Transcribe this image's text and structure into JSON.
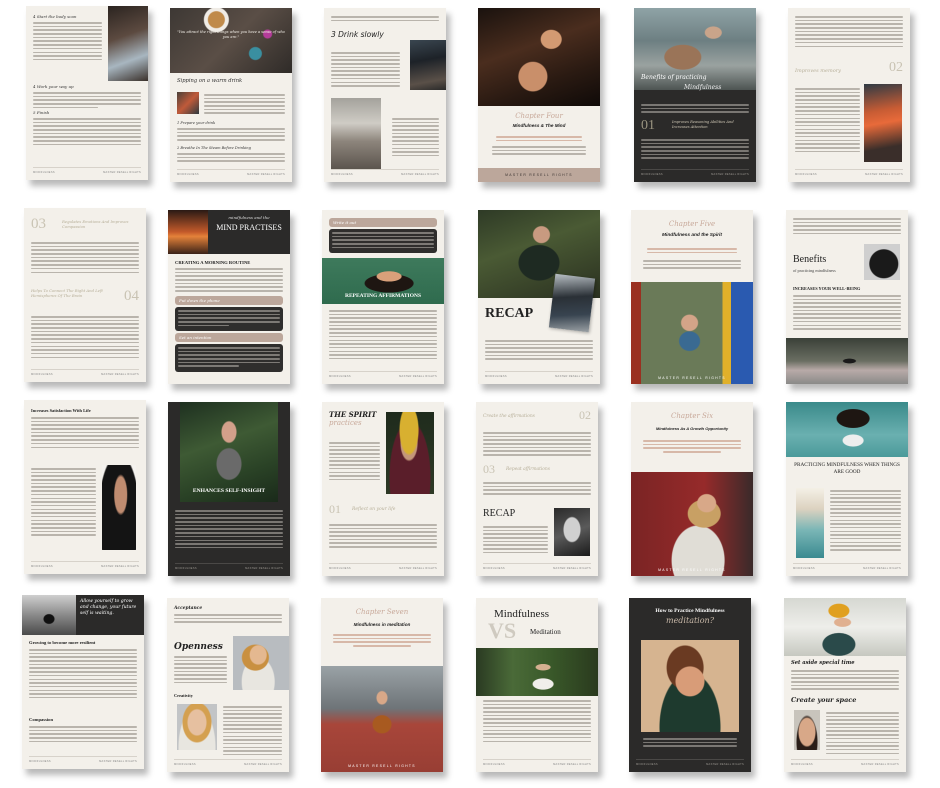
{
  "collage": {
    "footer_left": "MINDFULNESS",
    "footer_right": "MASTER RESELL RIGHTS",
    "brand_band": "MASTER RESELL RIGHTS",
    "pages": [
      {
        "id": "p1",
        "headings": [
          "4 Start the body scan",
          "4 Work your way up",
          "5 Finish"
        ]
      },
      {
        "id": "p2",
        "quote": "\"You attract the right things when you have a sense of who you are.\"",
        "title": "Sipping on a warm drink",
        "subs": [
          "1 Prepare your drink",
          "2 Breathe In The Steam Before Drinking"
        ]
      },
      {
        "id": "p3",
        "title": "3 Drink slowly"
      },
      {
        "id": "p4",
        "script": "Chapter Four",
        "title": "Mindfulness & The Mind",
        "band": "MASTER RESELL RIGHTS"
      },
      {
        "id": "p5",
        "title": "Benefits of practicing",
        "script": "Mindfulness",
        "num": "01",
        "subtitle": "Improves Reasoning Abilities And Increases Attention"
      },
      {
        "id": "p6",
        "subtitle": "Improves memory",
        "num": "02"
      },
      {
        "id": "p7",
        "num1": "03",
        "sub1": "Regulates Emotions And Improves Compassion",
        "num2": "04",
        "sub2": "Helps To Connect The Right And Left Hemispheres Of The Brain"
      },
      {
        "id": "p8",
        "script": "mindfulness and the",
        "title": "MIND PRACTISES",
        "heading": "CREATING A MORNING ROUTINE",
        "pill1": "Put down the phone",
        "pill2": "Set an intention"
      },
      {
        "id": "p9",
        "pill": "Write it out",
        "title": "REPEATING AFFIRMATIONS"
      },
      {
        "id": "p10",
        "title": "RECAP"
      },
      {
        "id": "p11",
        "script": "Chapter Five",
        "title": "Mindfulness and the Spirit",
        "band": "MASTER RESELL RIGHTS"
      },
      {
        "id": "p12",
        "title": "Benefits",
        "subtitle": "of practicing mindfulness",
        "heading": "INCREASES YOUR WELL-BEING"
      },
      {
        "id": "p13",
        "heading": "Increases Satisfaction With Life"
      },
      {
        "id": "p14",
        "title": "ENHANCES SELF-INSIGHT"
      },
      {
        "id": "p15",
        "title": "THE SPIRIT",
        "script": "practices",
        "num": "01",
        "subtitle": "Reflect on your life"
      },
      {
        "id": "p16",
        "sub1": "Create the affirmations",
        "num1": "02",
        "num2": "03",
        "sub2": "Repeat affirmations",
        "title": "RECAP"
      },
      {
        "id": "p17",
        "script": "Chapter Six",
        "title": "Mindfulness As A Growth Opportunity",
        "band": "MASTER RESELL RIGHTS"
      },
      {
        "id": "p18",
        "title": "PRACTICING MINDFULNESS WHEN THINGS ARE GOOD"
      },
      {
        "id": "p19",
        "quote": "Allow yourself to grow and change, your future self is waiting.",
        "heading1": "Growing to become more resilient",
        "heading2": "Compassion"
      },
      {
        "id": "p20",
        "heading1": "Acceptance",
        "title": "Openness",
        "heading2": "Creativity"
      },
      {
        "id": "p21",
        "script": "Chapter Seven",
        "title": "Mindfulness in meditation",
        "band": "MASTER RESELL RIGHTS"
      },
      {
        "id": "p22",
        "title1": "Mindfulness",
        "vs": "VS",
        "title2": "Meditation"
      },
      {
        "id": "p23",
        "title": "How to Practice Mindfulness",
        "script": "meditation?"
      },
      {
        "id": "p24",
        "heading1": "Set aside special time",
        "heading2": "Create your space"
      }
    ]
  },
  "colors": {
    "cream": "#f3f0ea",
    "dark": "#2b2a29",
    "taupe": "#bca79b",
    "muted_num": "#c9c3b3",
    "script": "#c8a99a"
  }
}
